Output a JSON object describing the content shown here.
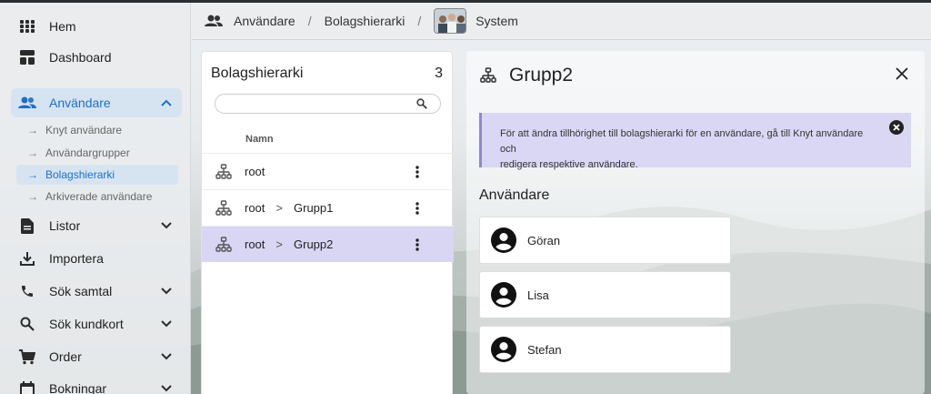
{
  "sidebar": {
    "items": [
      {
        "label": "Hem",
        "icon": "grid-icon"
      },
      {
        "label": "Dashboard",
        "icon": "dashboard-icon"
      },
      {
        "label": "Användare",
        "icon": "people-icon",
        "active": true
      },
      {
        "label": "Listor",
        "icon": "document-icon"
      },
      {
        "label": "Importera",
        "icon": "download-icon"
      },
      {
        "label": "Sök samtal",
        "icon": "phone-icon"
      },
      {
        "label": "Sök kundkort",
        "icon": "search-icon"
      },
      {
        "label": "Order",
        "icon": "cart-icon"
      },
      {
        "label": "Bokningar",
        "icon": "calendar-icon"
      }
    ],
    "subitems": [
      {
        "label": "Knyt användare"
      },
      {
        "label": "Användargrupper"
      },
      {
        "label": "Bolagshierarki",
        "active": true
      },
      {
        "label": "Arkiverade användare"
      }
    ]
  },
  "breadcrumb": {
    "users": "Användare",
    "sep1": "/",
    "hierarchy": "Bolagshierarki",
    "sep2": "/",
    "current": "System"
  },
  "list": {
    "title": "Bolagshierarki",
    "count": "3",
    "search_placeholder": "",
    "column": "Namn",
    "rows": [
      {
        "parts": [
          "root"
        ],
        "selected": false
      },
      {
        "parts": [
          "root",
          "Grupp1"
        ],
        "selected": false
      },
      {
        "parts": [
          "root",
          "Grupp2"
        ],
        "selected": true
      }
    ],
    "separator": ">"
  },
  "detail": {
    "title": "Grupp2",
    "banner_line1": "För att ändra tillhörighet till bolagshierarki för en användare, gå till Knyt användare och",
    "banner_line2": "redigera respektive användare.",
    "section": "Användare",
    "users": [
      "Göran",
      "Lisa",
      "Stefan"
    ]
  },
  "colors": {
    "accent": "#1e6fc6",
    "selected_row": "#d8d6f3",
    "banner_bg": "#d9d7f4",
    "banner_border": "#8e87d6"
  }
}
